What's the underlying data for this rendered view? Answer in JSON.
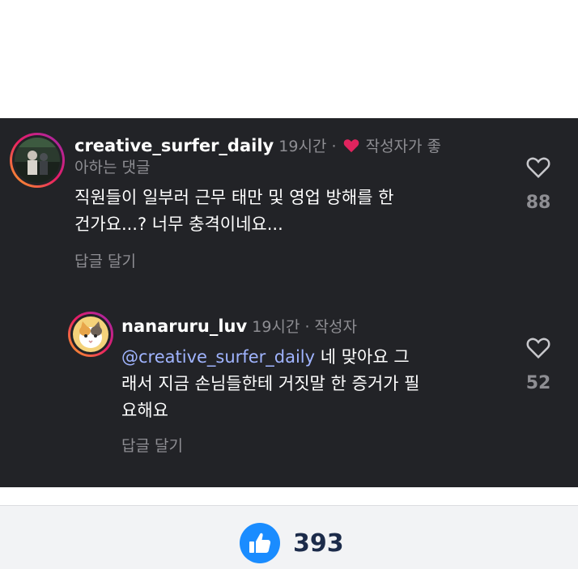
{
  "comments": [
    {
      "username": "creative_surfer_daily",
      "time": "19시간",
      "separator": "·",
      "badge_line1": "작성자가 좋",
      "badge_line2": "아하는 댓글",
      "text_line1": "직원들이 일부러 근무 태만 및 영업 방해를 한",
      "text_line2": "건가요...? 너무 충격이네요...",
      "reply_label": "답글 달기",
      "like_count": "88"
    },
    {
      "username": "nanaruru_luv",
      "time": "19시간",
      "separator": "·",
      "badge": "작성자",
      "mention": "@creative_surfer_daily",
      "text_line1_rest": " 네 맞아요 그",
      "text_line2": "래서 지금 손님들한테 거짓말 한 증거가 필",
      "text_line3": "요해요",
      "reply_label": "답글 달기",
      "like_count": "52"
    }
  ],
  "reactions": {
    "icon": "thumbs-up-icon",
    "count": "393"
  },
  "colors": {
    "panel": "#222327",
    "mention": "#a0b4ff",
    "heart": "#e0245e",
    "like_blue": "#1a8cff"
  }
}
